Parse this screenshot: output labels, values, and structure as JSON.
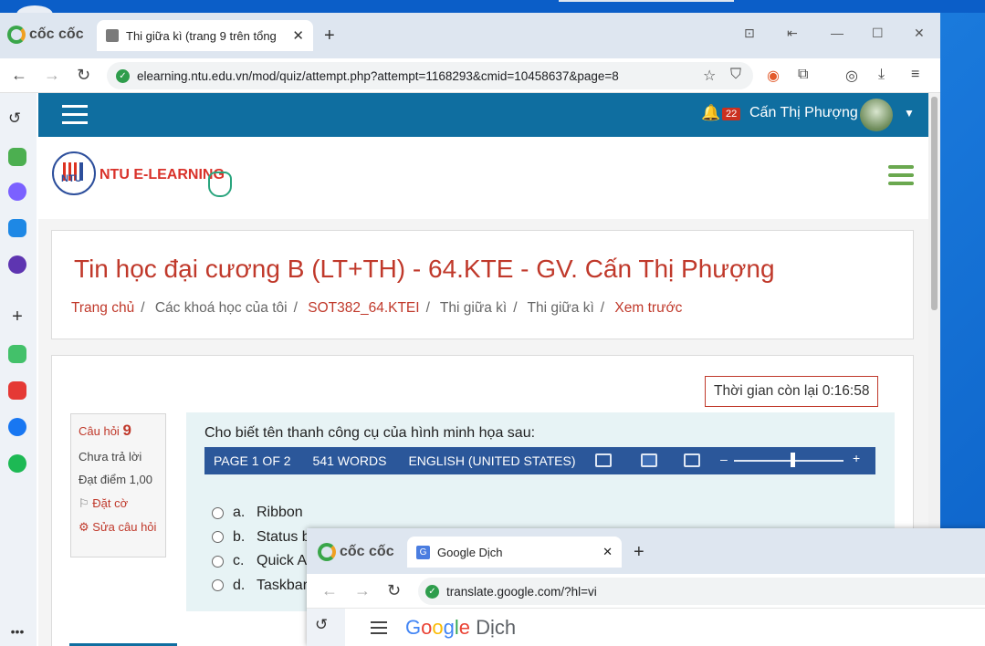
{
  "browser": {
    "brand": "cốc cốc",
    "tab_title": "Thi giữa kì (trang 9 trên tổng",
    "tab_close": "✕",
    "new_tab": "+",
    "url": "elearning.ntu.edu.vn/mod/quiz/attempt.php?attempt=1168293&cmid=10458637&page=8"
  },
  "site": {
    "notification_count": "22",
    "user_name": "Cấn Thị Phượng",
    "brand_text": "NTU E-LEARNING",
    "logo_text": "NTU"
  },
  "course": {
    "title": "Tin học đại cương B (LT+TH) - 64.KTE - GV. Cấn Thị Phượng",
    "breadcrumb": [
      "Trang chủ",
      "Các khoá học của tôi",
      "SOT382_64.KTEI",
      "Thi giữa kì",
      "Thi giữa kì",
      "Xem trước"
    ]
  },
  "quiz": {
    "timer": "Thời gian còn lại 0:16:58",
    "question_label": "Câu hỏi",
    "question_number": "9",
    "status": "Chưa trả lời",
    "points": "Đạt điểm 1,00",
    "flag": "Đặt cờ",
    "edit": "Sửa câu hỏi",
    "question_text": "Cho biết tên thanh công cụ của hình minh họa sau:",
    "word_status": [
      "PAGE 1 OF 2",
      "541 WORDS",
      "ENGLISH (UNITED STATES)"
    ],
    "options": [
      {
        "letter": "a.",
        "text": "Ribbon"
      },
      {
        "letter": "b.",
        "text": "Status b"
      },
      {
        "letter": "c.",
        "text": "Quick A"
      },
      {
        "letter": "d.",
        "text": "Taskbar"
      }
    ]
  },
  "second_window": {
    "brand": "cốc cốc",
    "tab_title": "Google Dịch",
    "url": "translate.google.com/?hl=vi",
    "app_name_rest": "Dịch"
  }
}
